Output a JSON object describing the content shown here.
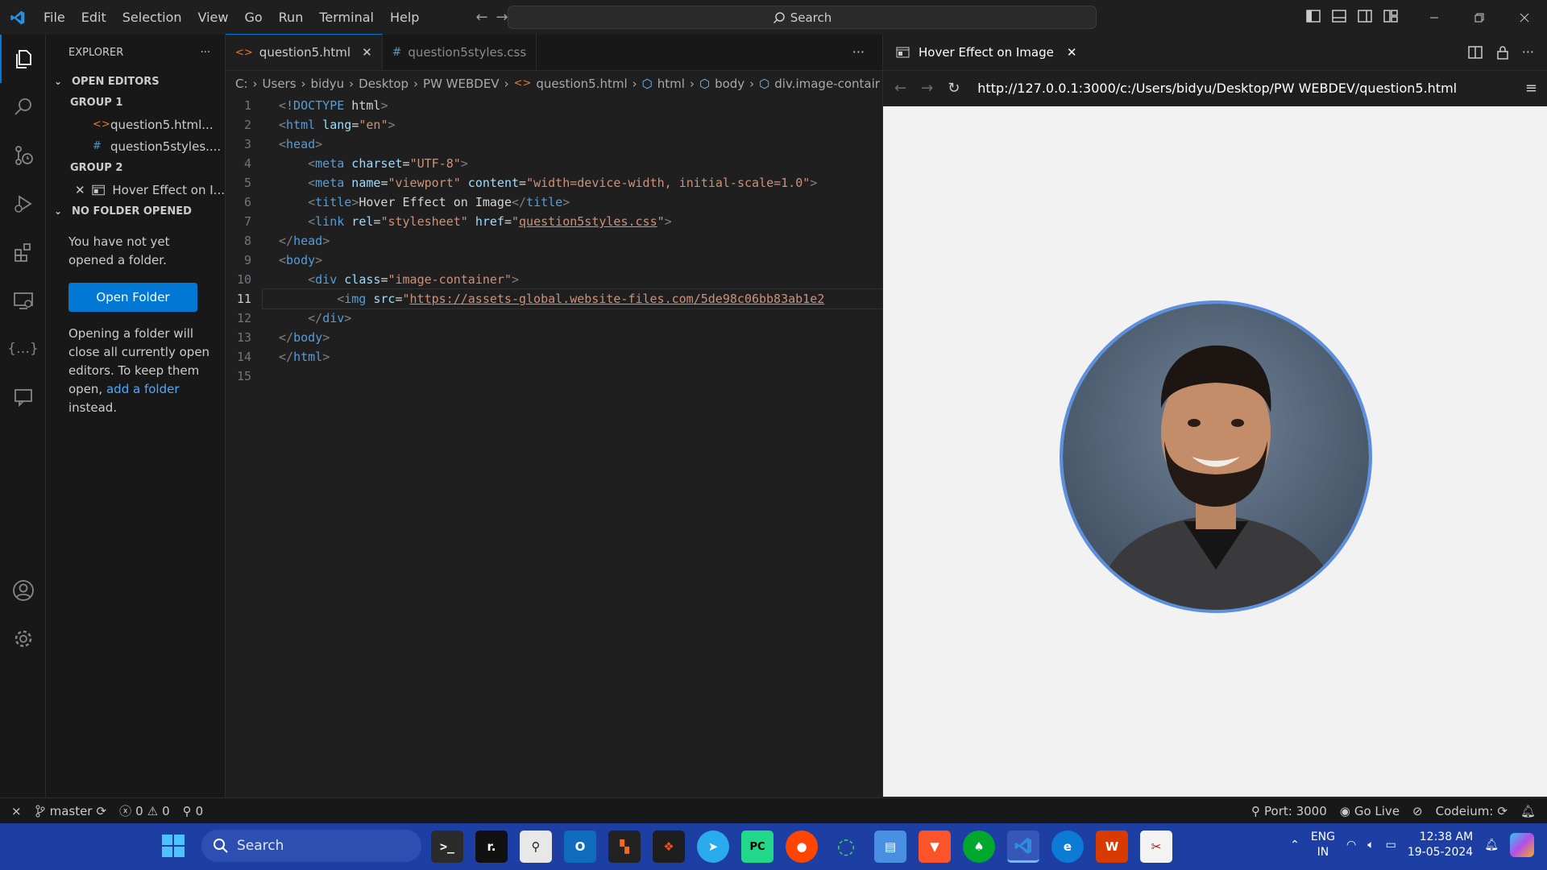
{
  "titlebar": {
    "menu": [
      "File",
      "Edit",
      "Selection",
      "View",
      "Go",
      "Run",
      "Terminal",
      "Help"
    ],
    "search_label": "Search"
  },
  "sidebar": {
    "title": "EXPLORER",
    "more": "···",
    "open_editors": "OPEN EDITORS",
    "group1": "GROUP 1",
    "group1_files": [
      {
        "icon": "<>",
        "name": "question5.html..."
      },
      {
        "icon": "#",
        "name": "question5styles...."
      }
    ],
    "group2": "GROUP 2",
    "group2_files": [
      {
        "name": "Hover Effect on I..."
      }
    ],
    "no_folder_title": "NO FOLDER OPENED",
    "no_folder_msg": "You have not yet opened a folder.",
    "open_folder_button": "Open Folder",
    "note_before": "Opening a folder will close all currently open editors. To keep them open, ",
    "note_link": "add a folder",
    "note_after": " instead."
  },
  "editor": {
    "tabs": [
      {
        "icon": "<>",
        "label": "question5.html",
        "active": true
      },
      {
        "icon": "#",
        "label": "question5styles.css",
        "active": false
      }
    ],
    "tab_more": "···",
    "breadcrumb": [
      "C:",
      "Users",
      "bidyu",
      "Desktop",
      "PW WEBDEV",
      "question5.html",
      "html",
      "body",
      "div.image-contair"
    ],
    "current_line": 11,
    "lines": [
      "<!DOCTYPE html>",
      "<html lang=\"en\">",
      "<head>",
      "    <meta charset=\"UTF-8\">",
      "    <meta name=\"viewport\" content=\"width=device-width, initial-scale=1.0\">",
      "    <title>Hover Effect on Image</title>",
      "    <link rel=\"stylesheet\" href=\"question5styles.css\">",
      "</head>",
      "<body>",
      "    <div class=\"image-container\">",
      "        <img src=\"https://assets-global.website-files.com/5de98c06bb83ab1e2",
      "    </div>",
      "</body>",
      "</html>",
      ""
    ]
  },
  "preview": {
    "tab_label": "Hover Effect on Image",
    "url": "http://127.0.0.1:3000/c:/Users/bidyu/Desktop/PW WEBDEV/question5.html"
  },
  "statusbar": {
    "branch": "master",
    "errors": "0",
    "warnings": "0",
    "ports": "0",
    "port": "Port: 3000",
    "golive": "Go Live",
    "codeium": "Codeium:"
  },
  "taskbar": {
    "search": "Search",
    "lang_top": "ENG",
    "lang_bottom": "IN",
    "time": "12:38 AM",
    "date": "19-05-2024"
  },
  "colors": {
    "accent": "#0078d4",
    "taskbar": "#1d3fa4",
    "portrait_border": "#5b8fe0"
  }
}
